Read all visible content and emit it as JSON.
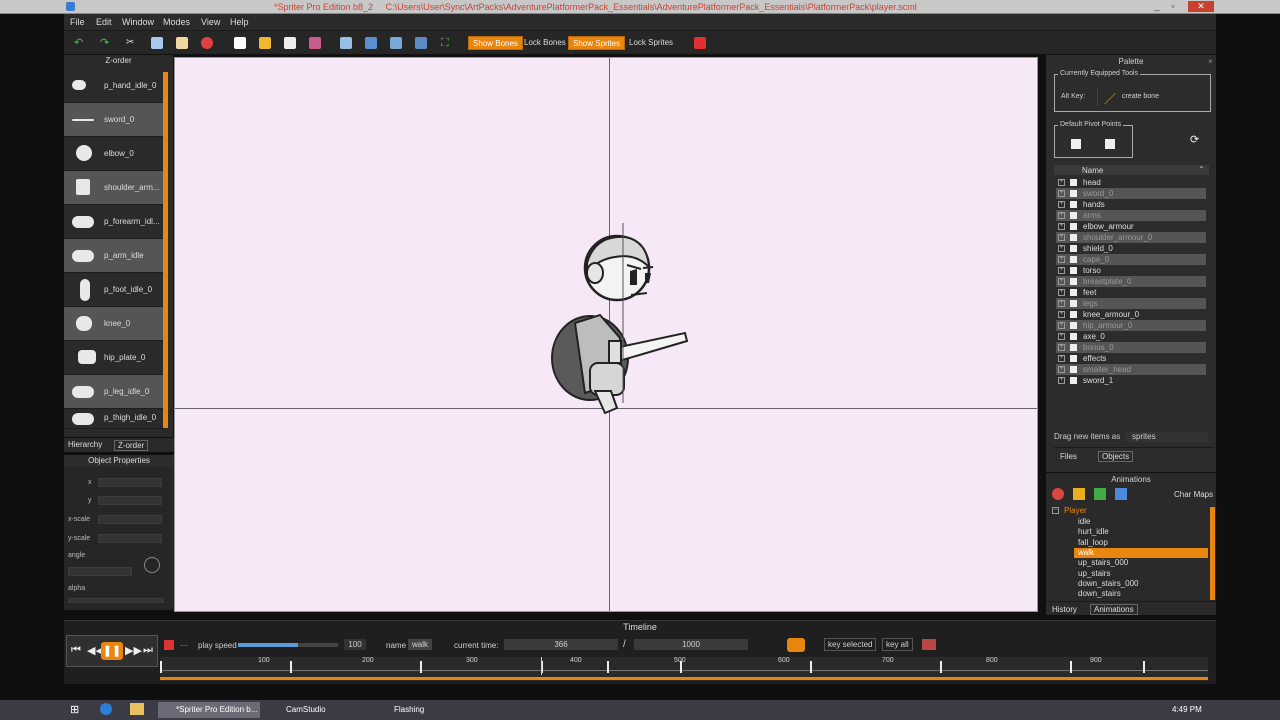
{
  "window": {
    "title": "*Spriter Pro Edition b8_2",
    "path": "C:\\Users\\User\\Sync\\ArtPacks\\AdventurePlatformerPack_Essentials\\AdventurePlatformerPack_Essentials\\PlatformerPack\\player.scml"
  },
  "menu": [
    "File",
    "Edit",
    "Window",
    "Modes",
    "View",
    "Help"
  ],
  "toolbar": {
    "show_bones": "Show Bones",
    "lock_bones": "Lock Bones",
    "show_sprites": "Show Sprites",
    "lock_sprites": "Lock Sprites"
  },
  "zorder": {
    "title": "Z-order",
    "items": [
      "p_hand_idle_0",
      "sword_0",
      "elbow_0",
      "shoulder_arm...",
      "p_forearm_idl...",
      "p_arm_idle",
      "p_foot_idle_0",
      "knee_0",
      "hip_plate_0",
      "p_leg_idle_0",
      "p_thigh_idle_0"
    ],
    "tabs": [
      "Hierarchy",
      "Z-order"
    ]
  },
  "object_properties": {
    "title": "Object Properties",
    "fields": [
      "x",
      "y",
      "x-scale",
      "y-scale",
      "angle",
      "alpha"
    ]
  },
  "palette": {
    "title": "Palette",
    "equipped_tools": "Currently Equipped Tools",
    "alt_key": "Alt Key:",
    "tool": "create bone",
    "pivot_points": "Default Pivot Points"
  },
  "files": {
    "header": "Name",
    "items": [
      "head",
      "sword_0",
      "hands",
      "arms",
      "elbow_armour",
      "shoulder_armour_0",
      "shield_0",
      "cape_0",
      "torso",
      "breastplate_0",
      "feet",
      "legs",
      "knee_armour_0",
      "hip_armour_0",
      "axe_0",
      "bonus_0",
      "effects",
      "smaller_head",
      "sword_1"
    ],
    "drag_label": "Drag new items as",
    "drag_value": "sprites",
    "tabs": [
      "Files",
      "Objects"
    ]
  },
  "animations": {
    "title": "Animations",
    "char_maps": "Char Maps",
    "entity": "Player",
    "items": [
      "idle",
      "hurt_idle",
      "fall_loop",
      "walk",
      "up_stairs_000",
      "up_stairs",
      "down_stairs_000",
      "down_stairs"
    ],
    "selected": "walk",
    "tabs": [
      "History",
      "Animations"
    ]
  },
  "timeline": {
    "title": "Timeline",
    "play_speed_label": "play speed",
    "play_speed": "100",
    "play_speed_fraction": 0.6,
    "name_label": "name",
    "name": "walk",
    "current_time_label": "current time:",
    "current_time": "366",
    "slash": "/",
    "length": "1000",
    "key_selected": "key selected",
    "key_all": "key all",
    "ruler": [
      "100",
      "200",
      "300",
      "400",
      "500",
      "600",
      "700",
      "800",
      "900"
    ]
  },
  "taskbar": {
    "items": [
      "*Spriter Pro Edition b...",
      "CamStudio",
      "Flashing"
    ],
    "time": "4:49 PM"
  },
  "colors": {
    "accent": "#e8860f",
    "canvas": "#f7e8f7"
  }
}
